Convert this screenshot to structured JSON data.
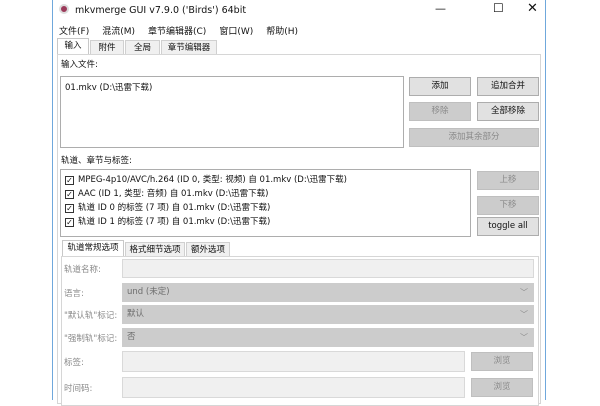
{
  "title": "mkvmerge GUI v7.9.0 ('Birds') 64bit",
  "menu": [
    "文件(F)",
    "混流(M)",
    "章节编辑器(C)",
    "窗口(W)",
    "帮助(H)"
  ],
  "tabs": [
    "输入",
    "附件",
    "全局",
    "章节编辑器"
  ],
  "input": {
    "label": "输入文件:",
    "files": [
      "01.mkv (D:\\迅雷下载)"
    ],
    "add": "添加",
    "append": "追加合并",
    "remove": "移除",
    "remove_all": "全部移除",
    "add_parts": "添加其余部分"
  },
  "tracks": {
    "label": "轨道、章节与标签:",
    "items": [
      "MPEG-4p10/AVC/h.264 (ID 0, 类型: 视频) 自 01.mkv (D:\\迅雷下载)",
      "AAC (ID 1, 类型: 音频) 自 01.mkv (D:\\迅雷下载)",
      "轨道 ID 0 的标签 (7 项) 自 01.mkv (D:\\迅雷下载)",
      "轨道 ID 1 的标签 (7 项) 自 01.mkv (D:\\迅雷下载)"
    ],
    "up": "上移",
    "down": "下移",
    "toggle_all": "toggle all"
  },
  "subtabs": [
    "轨道常规选项",
    "格式细节选项",
    "额外选项"
  ],
  "form": {
    "track_name": "轨道名称:",
    "language": "语言:",
    "language_value": "und (未定)",
    "default_flag": "\"默认轨\"标记:",
    "default_value": "默认",
    "forced_flag": "\"强制轨\"标记:",
    "forced_value": "否",
    "tags": "标签:",
    "timecodes": "时间码:",
    "browse": "浏览"
  }
}
